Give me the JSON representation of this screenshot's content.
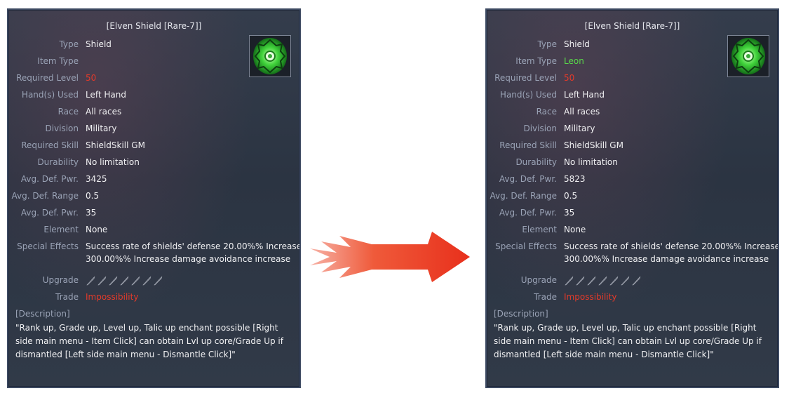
{
  "panels": [
    {
      "title": "[Elven Shield [Rare-7]]",
      "rows": [
        {
          "label": "Type",
          "value": "Shield",
          "style": ""
        },
        {
          "label": "Item Type",
          "value": "",
          "style": ""
        },
        {
          "label": "Required Level",
          "value": "50",
          "style": "red"
        },
        {
          "label": "Hand(s) Used",
          "value": "Left Hand",
          "style": ""
        },
        {
          "label": "Race",
          "value": "All races",
          "style": ""
        },
        {
          "label": "Division",
          "value": "Military",
          "style": ""
        },
        {
          "label": "Required Skill",
          "value": "ShieldSkill GM",
          "style": ""
        },
        {
          "label": "Durability",
          "value": "No limitation",
          "style": ""
        },
        {
          "label": "Avg. Def. Pwr.",
          "value": "3425",
          "style": ""
        },
        {
          "label": "Avg. Def. Range",
          "value": "0.5",
          "style": ""
        },
        {
          "label": "Avg. Def. Pwr.",
          "value": "35",
          "style": ""
        },
        {
          "label": "Element",
          "value": "None",
          "style": ""
        },
        {
          "label": "Special Effects",
          "value": "Success rate of shields' defense 20.00%% Increase",
          "value2": "300.00%% Increase damage avoidance increase",
          "style": ""
        },
        {
          "label": "Upgrade",
          "value": "",
          "style": ""
        },
        {
          "label": "Trade",
          "value": "Impossibility",
          "style": "red"
        }
      ],
      "description_label": "[Description]",
      "description": "\"Rank up, Grade up, Level up, Talic up enchant possible [Right side main menu - Item Click] can obtain Lvl up core/Grade Up if dismantled [Left side main menu - Dismantle Click]\"",
      "upgrade_slots": 7,
      "icon": "elven-shield-icon"
    },
    {
      "title": "[Elven Shield [Rare-7]]",
      "rows": [
        {
          "label": "Type",
          "value": "Shield",
          "style": ""
        },
        {
          "label": "Item Type",
          "value": "Leon",
          "style": "green"
        },
        {
          "label": "Required Level",
          "value": "50",
          "style": "red"
        },
        {
          "label": "Hand(s) Used",
          "value": "Left Hand",
          "style": ""
        },
        {
          "label": "Race",
          "value": "All races",
          "style": ""
        },
        {
          "label": "Division",
          "value": "Military",
          "style": ""
        },
        {
          "label": "Required Skill",
          "value": "ShieldSkill GM",
          "style": ""
        },
        {
          "label": "Durability",
          "value": "No limitation",
          "style": ""
        },
        {
          "label": "Avg. Def. Pwr.",
          "value": "5823",
          "style": ""
        },
        {
          "label": "Avg. Def. Range",
          "value": "0.5",
          "style": ""
        },
        {
          "label": "Avg. Def. Pwr.",
          "value": "35",
          "style": ""
        },
        {
          "label": "Element",
          "value": "None",
          "style": ""
        },
        {
          "label": "Special Effects",
          "value": "Success rate of shields' defense 20.00%% Increase",
          "value2": "300.00%% Increase damage avoidance increase",
          "style": ""
        },
        {
          "label": "Upgrade",
          "value": "",
          "style": ""
        },
        {
          "label": "Trade",
          "value": "Impossibility",
          "style": "red"
        }
      ],
      "description_label": "[Description]",
      "description": "\"Rank up, Grade up, Level up, Talic up enchant possible [Right side main menu - Item Click] can obtain Lvl up core/Grade Up if dismantled [Left side main menu - Dismantle Click]\"",
      "upgrade_slots": 7,
      "icon": "elven-shield-icon"
    }
  ],
  "arrow": {
    "icon": "right-arrow-icon",
    "color": "#e8301c"
  },
  "colors": {
    "label": "#9aa3b6",
    "value": "#f0f0f2",
    "red": "#e33a2a",
    "green": "#59d84a"
  }
}
